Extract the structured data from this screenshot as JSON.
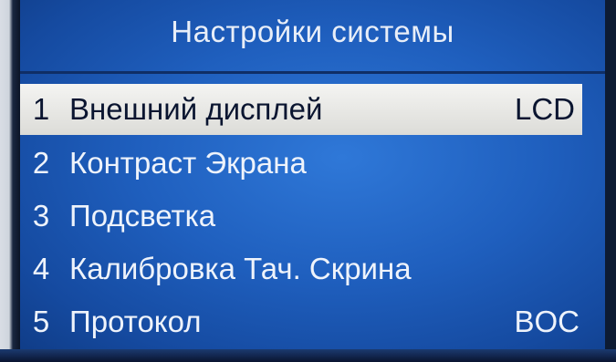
{
  "screen": {
    "title": "Настройки системы"
  },
  "menu": {
    "items": [
      {
        "number": "1",
        "label": "Внешний дисплей",
        "value": "LCD",
        "selected": true
      },
      {
        "number": "2",
        "label": "Контраст Экрана",
        "value": ""
      },
      {
        "number": "3",
        "label": "Подсветка",
        "value": ""
      },
      {
        "number": "4",
        "label": "Калибровка Тач. Скрина",
        "value": ""
      },
      {
        "number": "5",
        "label": "Протокол",
        "value": "BOC"
      }
    ]
  },
  "colors": {
    "screen_bg": "#1f5fbe",
    "highlight_bg": "#ececea",
    "text": "#eef3fb"
  }
}
